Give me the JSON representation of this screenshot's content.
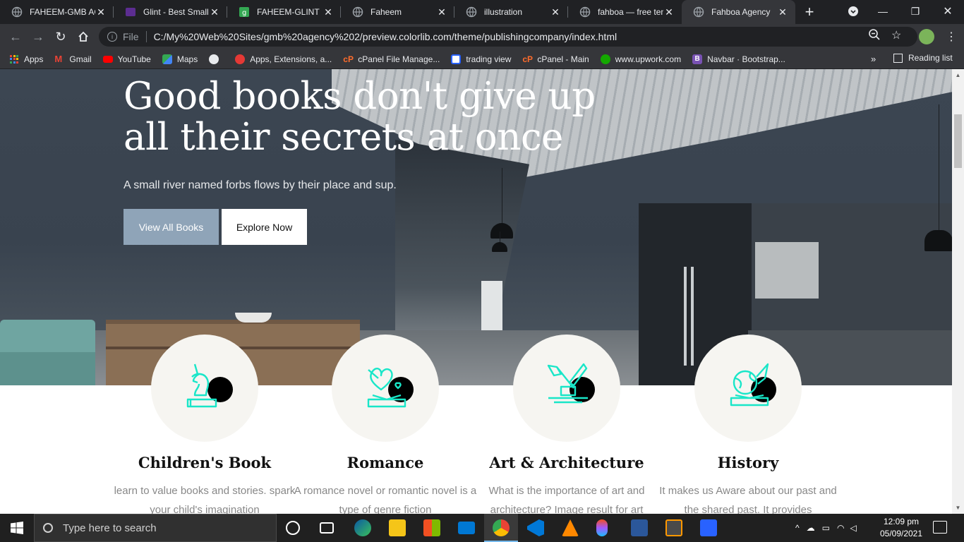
{
  "browser": {
    "tabs": [
      {
        "title": "FAHEEM-GMB AGENCY",
        "favicon_color": "#9aa0a6",
        "active": false
      },
      {
        "title": "Glint - Best Small",
        "favicon_color": "#5c2d91",
        "active": false
      },
      {
        "title": "FAHEEM-GLINT",
        "favicon_color": "#34a853",
        "active": false
      },
      {
        "title": "Faheem",
        "favicon_color": "#9aa0a6",
        "active": false
      },
      {
        "title": "illustration",
        "favicon_color": "#9aa0a6",
        "active": false
      },
      {
        "title": "fahboa — free template",
        "favicon_color": "#9aa0a6",
        "active": false
      },
      {
        "title": "Fahboa Agency",
        "favicon_color": "#9aa0a6",
        "active": true
      }
    ],
    "address": {
      "scheme_label": "File",
      "url": "C:/My%20Web%20Sites/gmb%20agency%202/preview.colorlib.com/theme/publishingcompany/index.html"
    },
    "bookmarks": [
      {
        "label": "Apps",
        "color": "#ea4335"
      },
      {
        "label": "Gmail",
        "color": "#ea4335"
      },
      {
        "label": "YouTube",
        "color": "#ff0000"
      },
      {
        "label": "Maps",
        "color": "#34a853"
      },
      {
        "label": "",
        "color": "#e8eaed"
      },
      {
        "label": "Apps, Extensions, a...",
        "color": "#e53935"
      },
      {
        "label": "cPanel File Manage...",
        "color": "#ff6c2c"
      },
      {
        "label": "trading view",
        "color": "#2962ff"
      },
      {
        "label": "cPanel - Main",
        "color": "#ff6c2c"
      },
      {
        "label": "www.upwork.com",
        "color": "#14a800"
      },
      {
        "label": "Navbar · Bootstrap...",
        "color": "#7952b3"
      }
    ],
    "bookmarks_more": "»",
    "reading_list": "Reading list"
  },
  "hero": {
    "title_line1": "Good books don't give up",
    "title_line2": "all their secrets at once",
    "subtitle": "A small river named forbs flows by their place and sup.",
    "btn_primary": "View All Books",
    "btn_secondary": "Explore Now"
  },
  "categories": [
    {
      "title": "Children's Book",
      "text": "learn to value books and stories. spark your child's imagination",
      "icon": "unicorn-book-icon"
    },
    {
      "title": "Romance",
      "text": "A romance novel or romantic novel is a type of genre fiction",
      "icon": "heart-book-icon"
    },
    {
      "title": "Art & Architecture",
      "text": "What is the importance of art and architecture? Image result for art",
      "icon": "art-book-icon"
    },
    {
      "title": "History",
      "text": "It makes us Aware about our past and the shared past. It provides",
      "icon": "globe-book-icon"
    }
  ],
  "colors": {
    "accent_icon": "#19e6c8",
    "primary_button": "#8fa4b8"
  },
  "taskbar": {
    "search_placeholder": "Type here to search",
    "time": "12:09 pm",
    "date": "05/09/2021"
  }
}
